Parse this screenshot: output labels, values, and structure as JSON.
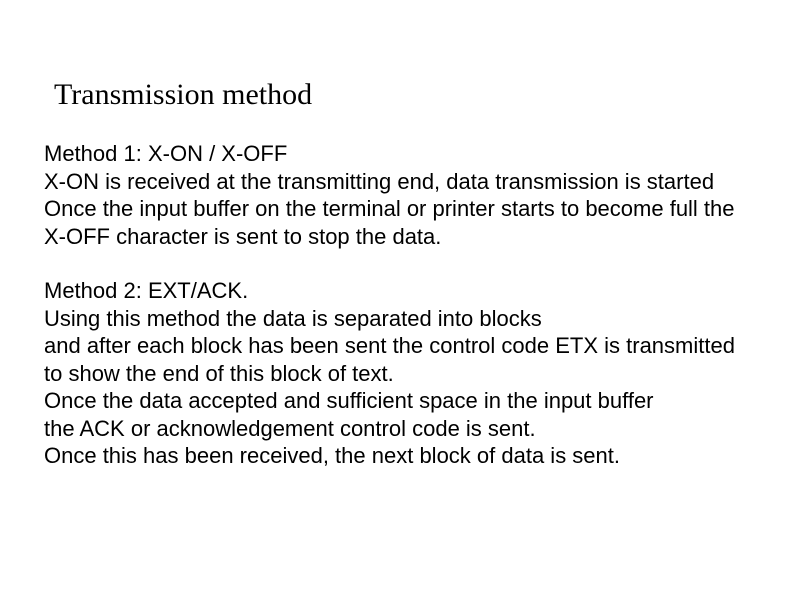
{
  "title": "Transmission method",
  "method1": {
    "heading": "Method 1: X-ON / X-OFF",
    "line1": "X-ON is received at the transmitting end, data transmission is started",
    "line2": "Once the input buffer on the terminal or printer starts to become full the X-OFF character is sent to stop the data."
  },
  "method2": {
    "heading": "Method 2: EXT/ACK.",
    "line1": "Using this method the data is separated into blocks",
    "line2": "and after each block has been sent the control code ETX is transmitted",
    "line3": "to show the end of this block of text.",
    "line4": "Once the data accepted and sufficient space in the input buffer",
    "line5": " the ACK or acknowledgement control code is sent.",
    "line6": "Once this has been received, the next block of data is sent."
  }
}
